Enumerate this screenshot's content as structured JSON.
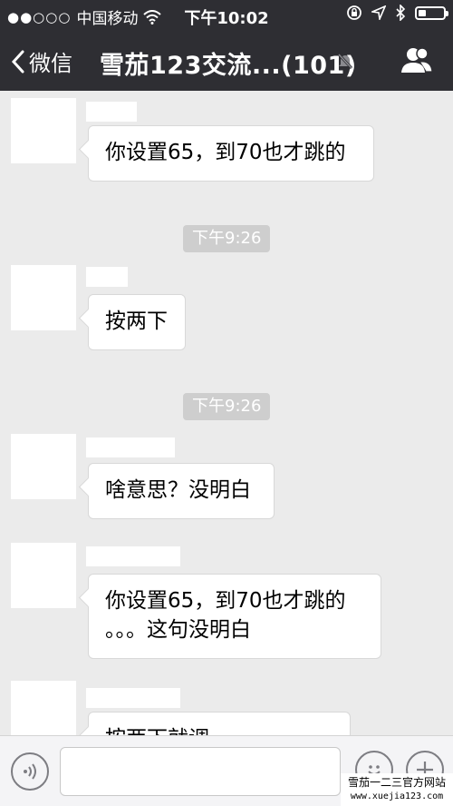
{
  "status_bar": {
    "carrier": "中国移动",
    "signal_dots": "●●○○○",
    "time": "下午10:02"
  },
  "nav": {
    "back_label": "微信",
    "title": "雪茄123交流...(101)"
  },
  "messages": [
    {
      "type": "incoming",
      "text": "你设置65，到70也才跳的"
    },
    {
      "type": "time",
      "text": "下午9:26"
    },
    {
      "type": "incoming",
      "text": "按两下"
    },
    {
      "type": "time",
      "text": "下午9:26"
    },
    {
      "type": "incoming",
      "text": "啥意思？没明白"
    },
    {
      "type": "incoming",
      "line1": "你设置65，到70也才跳的",
      "line2": "。。。这句没明白"
    },
    {
      "type": "incoming",
      "partial_text": "按两下就调..."
    }
  ],
  "input_bar": {
    "placeholder": ""
  },
  "watermark": {
    "line1": "雪茄一二三官方网站",
    "line2": "www.xuejia123.com"
  },
  "icons": {
    "back": "chevron-left-icon",
    "mute": "bell-slash-icon",
    "members": "people-icon",
    "voice": "voice-icon",
    "emoji": "emoji-icon",
    "more": "plus-icon"
  },
  "colors": {
    "header_bg": "#2e2e33",
    "chat_bg": "#ebebeb",
    "bubble_bg": "#ffffff",
    "time_badge_bg": "#cecece"
  }
}
